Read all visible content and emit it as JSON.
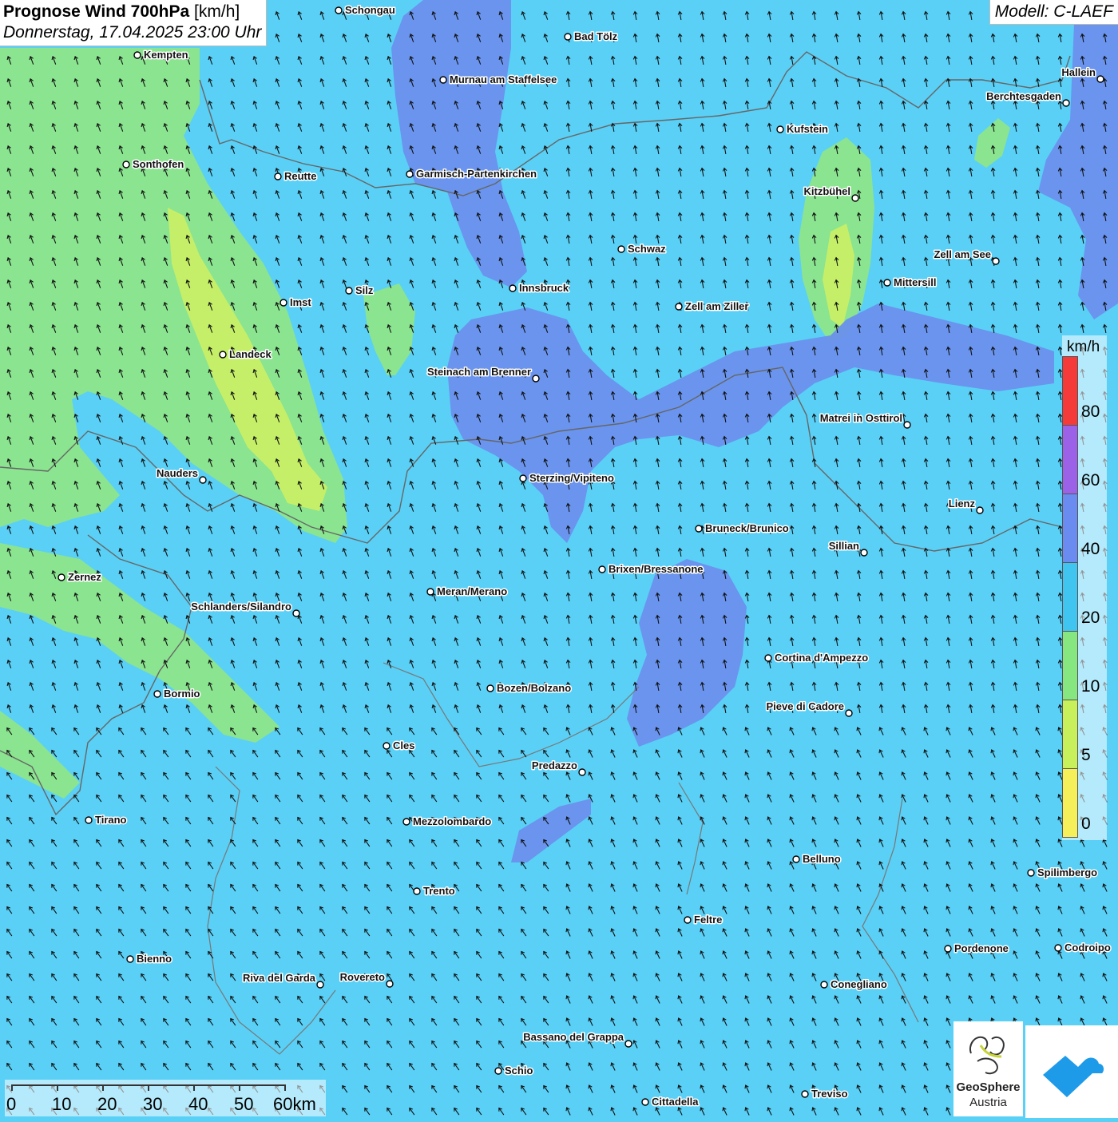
{
  "title": {
    "main": "Prognose Wind 700hPa",
    "unit": "[km/h]",
    "datetime": "Donnerstag, 17.04.2025 23:00 Uhr"
  },
  "model": "Modell: C-LAEF",
  "legend": {
    "unit": "km/h",
    "labels": [
      "80",
      "60",
      "40",
      "20",
      "10",
      "5",
      "0"
    ],
    "colors": [
      "#f53a3a",
      "#9b62e8",
      "#6a8cf0",
      "#3fc5ef",
      "#86e680",
      "#c8f05a",
      "#f5f05a"
    ]
  },
  "scalebar": {
    "labels": [
      "0",
      "10",
      "20",
      "30",
      "40",
      "50",
      "60km"
    ]
  },
  "logos": {
    "geosphere_name": "GeoSphere",
    "geosphere_sub": "Austria"
  },
  "cities": [
    {
      "name": "Schongau",
      "label_side": "right"
    },
    {
      "name": "Bad Tölz",
      "label_side": "right"
    },
    {
      "name": "Kempten",
      "label_side": "right"
    },
    {
      "name": "Murnau am Staffelsee",
      "label_side": "right"
    },
    {
      "name": "Hallein",
      "label_side": "left"
    },
    {
      "name": "Berchtesgaden",
      "label_side": "left"
    },
    {
      "name": "Kufstein",
      "label_side": "right"
    },
    {
      "name": "Sonthofen",
      "label_side": "right"
    },
    {
      "name": "Reutte",
      "label_side": "right"
    },
    {
      "name": "Garmisch-Partenkirchen",
      "label_side": "right"
    },
    {
      "name": "Kitzbühel",
      "label_side": "left"
    },
    {
      "name": "Schwaz",
      "label_side": "right"
    },
    {
      "name": "Zell am See",
      "label_side": "left"
    },
    {
      "name": "Innsbruck",
      "label_side": "right"
    },
    {
      "name": "Mittersill",
      "label_side": "right"
    },
    {
      "name": "Silz",
      "label_side": "right"
    },
    {
      "name": "Imst",
      "label_side": "right"
    },
    {
      "name": "Zell am Ziller",
      "label_side": "right"
    },
    {
      "name": "Landeck",
      "label_side": "right"
    },
    {
      "name": "Steinach am Brenner",
      "label_side": "left"
    },
    {
      "name": "Matrei in Osttirol",
      "label_side": "left"
    },
    {
      "name": "Nauders",
      "label_side": "left"
    },
    {
      "name": "Sterzing/Vipiteno",
      "label_side": "right"
    },
    {
      "name": "Lienz",
      "label_side": "left"
    },
    {
      "name": "Bruneck/Brunico",
      "label_side": "right"
    },
    {
      "name": "Sillian",
      "label_side": "left"
    },
    {
      "name": "Zernez",
      "label_side": "right"
    },
    {
      "name": "Brixen/Bressanone",
      "label_side": "right"
    },
    {
      "name": "Meran/Merano",
      "label_side": "right"
    },
    {
      "name": "Schlanders/Silandro",
      "label_side": "left"
    },
    {
      "name": "Cortina d'Ampezzo",
      "label_side": "right"
    },
    {
      "name": "Bozen/Bolzano",
      "label_side": "right"
    },
    {
      "name": "Bormio",
      "label_side": "right"
    },
    {
      "name": "Pieve di Cadore",
      "label_side": "left"
    },
    {
      "name": "Cles",
      "label_side": "right"
    },
    {
      "name": "Predazzo",
      "label_side": "left"
    },
    {
      "name": "Tirano",
      "label_side": "right"
    },
    {
      "name": "Mezzolombardo",
      "label_side": "right"
    },
    {
      "name": "Belluno",
      "label_side": "right"
    },
    {
      "name": "Spilimbergo",
      "label_side": "right"
    },
    {
      "name": "Trento",
      "label_side": "right"
    },
    {
      "name": "Feltre",
      "label_side": "right"
    },
    {
      "name": "Pordenone",
      "label_side": "right"
    },
    {
      "name": "Codroipo",
      "label_side": "right"
    },
    {
      "name": "Bienno",
      "label_side": "right"
    },
    {
      "name": "Riva del Garda",
      "label_side": "left"
    },
    {
      "name": "Rovereto",
      "label_side": "left"
    },
    {
      "name": "Conegliano",
      "label_side": "right"
    },
    {
      "name": "Bassano del Grappa",
      "label_side": "left"
    },
    {
      "name": "Schio",
      "label_side": "right"
    },
    {
      "name": "Treviso",
      "label_side": "right"
    },
    {
      "name": "Cittadella",
      "label_side": "right"
    }
  ]
}
